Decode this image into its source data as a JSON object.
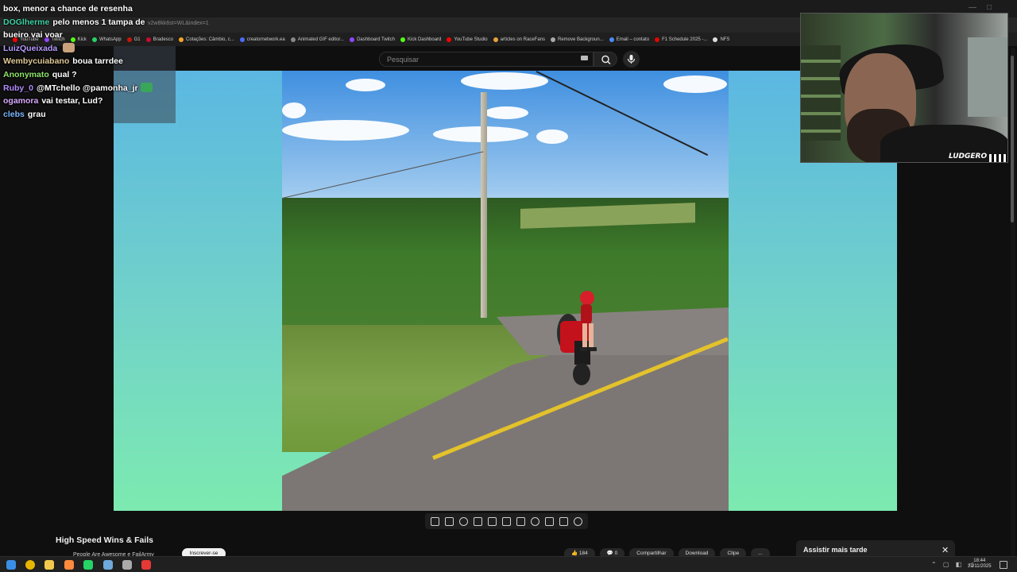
{
  "browser": {
    "url": "youtube.com/watch?v=...&list=WL&index=1",
    "url_visible": "v2w8kk6st=WL&index=1",
    "bookmarks": [
      {
        "label": "YouTube",
        "color": "#ff0000"
      },
      {
        "label": "Twitch",
        "color": "#9146ff"
      },
      {
        "label": "Kick",
        "color": "#53fc18"
      },
      {
        "label": "WhatsApp",
        "color": "#25d366"
      },
      {
        "label": "G1",
        "color": "#c4170c"
      },
      {
        "label": "Bradesco",
        "color": "#cc092f"
      },
      {
        "label": "Cotações: Câmbio, c...",
        "color": "#f5a623"
      },
      {
        "label": "creatornetwork.ea",
        "color": "#4a6cf7"
      },
      {
        "label": "Animated GIF editor...",
        "color": "#888888"
      },
      {
        "label": "Dashboard Twitch",
        "color": "#9146ff"
      },
      {
        "label": "Kick Dashboard",
        "color": "#53fc18"
      },
      {
        "label": "YouTube Studio",
        "color": "#ff0000"
      },
      {
        "label": "articles on RaceFans",
        "color": "#e8a23a"
      },
      {
        "label": "Remove Backgroun...",
        "color": "#aaaaaa"
      },
      {
        "label": "Email – contato",
        "color": "#4a8cf7"
      },
      {
        "label": "F1 Schedule 2025 -...",
        "color": "#e10600"
      },
      {
        "label": "NFS",
        "color": "#dddddd"
      }
    ]
  },
  "youtube": {
    "search_placeholder": "Pesquisar",
    "video_title": "High Speed Wins & Fails",
    "channel_name": "People Are Awesome e FailArmy",
    "subscribe_label": "Inscrever-se",
    "likes": "184",
    "comments": "0",
    "share_label": "Compartilhar",
    "download_label": "Download",
    "clip_label": "Clipe",
    "more_label": "...",
    "watch_later_title": "Assistir mais tarde",
    "close_glyph": "✕"
  },
  "chat": {
    "messages": [
      {
        "user": "",
        "text": "box, menor a chance de resenha",
        "color": "#ffffff"
      },
      {
        "user": "DOGlherme",
        "text": "pelo menos 1 tampa de",
        "color": "#3fd1a5"
      },
      {
        "user": "",
        "text": "bueiro vai voar",
        "color": "#ffffff"
      },
      {
        "user": "LuizQueixada",
        "text": "",
        "color": "#b69cff",
        "emote": "#c9a27d"
      },
      {
        "user": "Wembycuiabano",
        "text": "boua tarrdee",
        "color": "#e0c896"
      },
      {
        "user": "Anonymato",
        "text": "qual ?",
        "color": "#8fe36b"
      },
      {
        "user": "Ruby_0",
        "text": "@MTchello @pamonha_jr",
        "color": "#b48cff",
        "emote": "#3aa65a"
      },
      {
        "user": "ogamora",
        "text": "vai testar, Lud?",
        "color": "#d8a9ff"
      },
      {
        "user": "clebs",
        "text": "grau",
        "color": "#7ab8ff"
      }
    ]
  },
  "webcam": {
    "logo_text": "LUDGERO"
  },
  "taskbar": {
    "time": "18:44",
    "date": "21/11/2025",
    "apps": [
      {
        "name": "windows-start-icon",
        "color": "#3a8ee6"
      },
      {
        "name": "chrome-icon",
        "color": "#e8b600"
      },
      {
        "name": "file-explorer-icon",
        "color": "#f2c94c"
      },
      {
        "name": "app-icon",
        "color": "#ff8a3d"
      },
      {
        "name": "whatsapp-icon",
        "color": "#25d366"
      },
      {
        "name": "app2-icon",
        "color": "#6fa8dc"
      },
      {
        "name": "app3-icon",
        "color": "#aaaaaa"
      },
      {
        "name": "app4-icon",
        "color": "#e53935"
      }
    ]
  }
}
